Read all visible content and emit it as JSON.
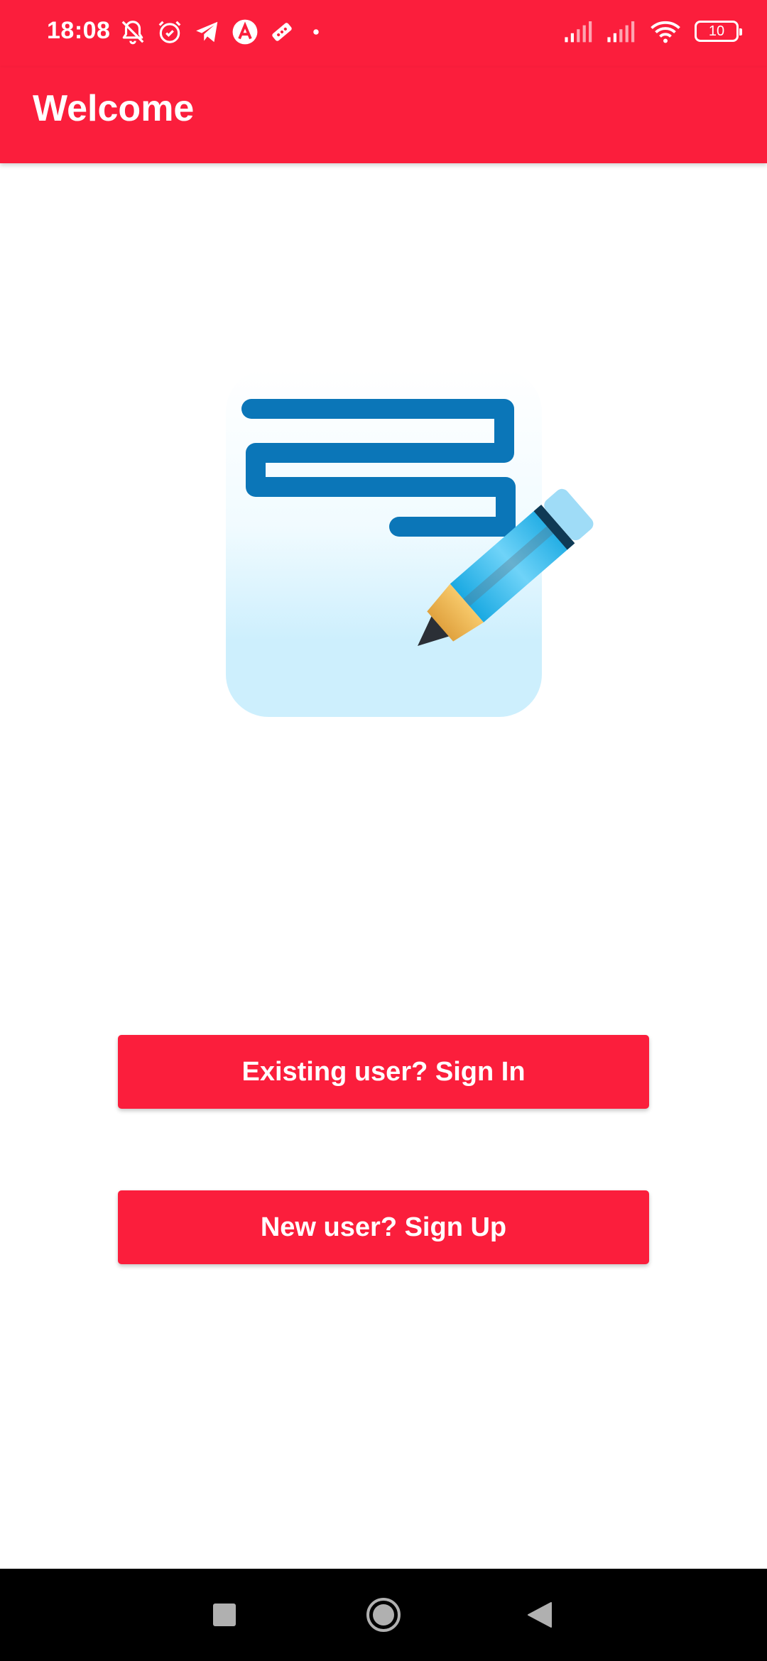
{
  "status_bar": {
    "time": "18:08",
    "battery_level": "10",
    "left_icons": [
      "bell-off-icon",
      "alarm-icon",
      "telegram-icon",
      "app-a-icon",
      "ticket-icon",
      "dot-icon"
    ],
    "right_icons": [
      "signal-icon",
      "signal-icon",
      "wifi-icon",
      "battery-icon"
    ]
  },
  "app_bar": {
    "title": "Welcome"
  },
  "logo": {
    "icon": "note-pencil-logo-icon"
  },
  "buttons": {
    "sign_in_label": "Existing user? Sign In",
    "sign_up_label": "New user? Sign Up"
  },
  "nav_bar": {
    "icons": [
      "recents-square-icon",
      "home-circle-icon",
      "back-triangle-icon"
    ]
  },
  "colors": {
    "primary": "#fb1e3c",
    "logo_blue": "#0b76b8",
    "pencil_blue": "#22b7ec",
    "logo_bg_light": "#cdeffd",
    "nav_bg": "#000000"
  }
}
